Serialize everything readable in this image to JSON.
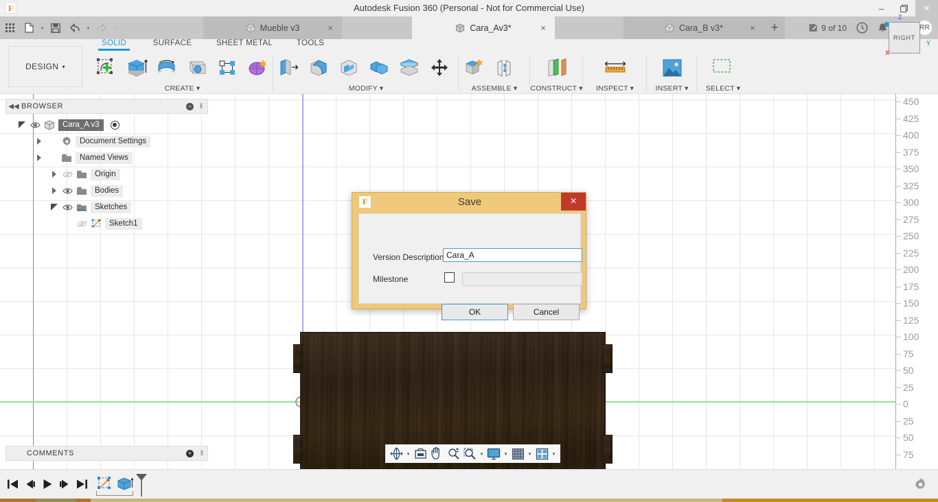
{
  "window": {
    "title": "Autodesk Fusion 360 (Personal - Not for Commercial Use)",
    "logo_glyph": "F",
    "minimize": "–",
    "restore": "❐",
    "close": "×"
  },
  "quick_access": {
    "grid_icon": "app-grid-icon",
    "new_icon": "new-document-icon",
    "save_icon": "save-icon",
    "undo_icon": "undo-icon",
    "redo_icon": "redo-icon",
    "caret": "▾"
  },
  "tabs": [
    {
      "label": "Mueble v3",
      "active": false,
      "close": "×"
    },
    {
      "label": "Cara_Av3*",
      "active": true,
      "close": "×"
    },
    {
      "label": "Cara_B v3*",
      "active": false,
      "close": "×"
    }
  ],
  "tab_extras": {
    "new_tab": "+",
    "jobs_label": "9 of 10",
    "jobs_icon": "job-status-icon",
    "history_icon": "clock-icon",
    "notification_icon": "bell-icon",
    "help_icon": "help-icon",
    "avatar_initials": "RR"
  },
  "ribbon": {
    "workspace_label": "DESIGN",
    "workspace_caret": "▾",
    "tabs": [
      {
        "label": "SOLID",
        "selected": true
      },
      {
        "label": "SURFACE",
        "selected": false
      },
      {
        "label": "SHEET METAL",
        "selected": false
      },
      {
        "label": "TOOLS",
        "selected": false
      }
    ],
    "panels": [
      {
        "title": "CREATE ▾",
        "icons": [
          "create-sketch-icon",
          "extrude-icon",
          "revolve-icon",
          "sweep-icon",
          "rib-icon",
          "form-icon"
        ]
      },
      {
        "title": "MODIFY ▾",
        "icons": [
          "press-pull-icon",
          "fillet-icon",
          "shell-icon",
          "combine-icon",
          "split-face-icon",
          "move-copy-icon"
        ]
      },
      {
        "title": "ASSEMBLE ▾",
        "icons": [
          "new-component-icon",
          "joint-icon"
        ]
      },
      {
        "title": "CONSTRUCT ▾",
        "icons": [
          "offset-plane-icon"
        ]
      },
      {
        "title": "INSPECT ▾",
        "icons": [
          "measure-icon"
        ]
      },
      {
        "title": "INSERT ▾",
        "icons": [
          "insert-image-icon"
        ]
      },
      {
        "title": "SELECT ▾",
        "icons": [
          "select-window-icon"
        ]
      }
    ]
  },
  "browser": {
    "panel_title": "BROWSER",
    "collapse_icon": "collapse-left-icon",
    "minus_icon": "−",
    "grip": "‖",
    "items": [
      {
        "label": "Cara_A v3",
        "indent": 60,
        "icon": "component-icon",
        "eye": "visible",
        "arrow": "open",
        "selected": true,
        "radio": true
      },
      {
        "label": "Document Settings",
        "indent": 85,
        "icon": "gear-icon",
        "eye": "none",
        "arrow": "closed",
        "selected": false,
        "radio": false
      },
      {
        "label": "Named Views",
        "indent": 85,
        "icon": "folder-icon",
        "eye": "none",
        "arrow": "closed",
        "selected": false,
        "radio": false
      },
      {
        "label": "Origin",
        "indent": 107,
        "icon": "folder-icon",
        "eye": "hidden",
        "arrow": "closed",
        "selected": false,
        "radio": false
      },
      {
        "label": "Bodies",
        "indent": 107,
        "icon": "folder-icon",
        "eye": "visible",
        "arrow": "closed",
        "selected": false,
        "radio": false
      },
      {
        "label": "Sketches",
        "indent": 107,
        "icon": "sketch-folder-icon",
        "eye": "visible",
        "arrow": "open",
        "selected": false,
        "radio": false
      },
      {
        "label": "Sketch1",
        "indent": 128,
        "icon": "sketch-icon",
        "eye": "hidden",
        "arrow": "none",
        "selected": false,
        "radio": false
      }
    ]
  },
  "comments": {
    "title": "COMMENTS",
    "plus_icon": "+",
    "grip": "‖"
  },
  "canvas": {
    "viewcube_label": "RIGHT",
    "axis_z": "Z",
    "axis_y": "Y",
    "axis_x": "X",
    "grid_color": "#e6e6e6",
    "ground_line_color": "#8ce88c",
    "sketch_line_color": "#a9a9ee",
    "model_name": "wood-panel-body",
    "model_color": "#2e1f12"
  },
  "ruler": {
    "unit_labels": [
      "450",
      "425",
      "400",
      "375",
      "350",
      "325",
      "300",
      "275",
      "250",
      "225",
      "200",
      "175",
      "150",
      "125",
      "100",
      "75",
      "50",
      "25",
      "0",
      "25",
      "50",
      "75"
    ],
    "zero_index": 18
  },
  "view_toolbar": {
    "items": [
      {
        "icon": "orbit-icon",
        "caret": true
      },
      {
        "icon": "look-at-icon",
        "caret": false
      },
      {
        "icon": "pan-icon",
        "caret": false
      },
      {
        "icon": "zoom-icon",
        "caret": false
      },
      {
        "icon": "zoom-window-icon",
        "caret": true
      },
      {
        "icon": "display-settings-icon",
        "caret": true
      },
      {
        "icon": "grid-snaps-icon",
        "caret": true
      },
      {
        "icon": "viewports-icon",
        "caret": true
      }
    ]
  },
  "timeline": {
    "buttons": [
      {
        "icon": "go-to-beginning-icon"
      },
      {
        "icon": "step-back-icon"
      },
      {
        "icon": "play-icon"
      },
      {
        "icon": "step-forward-icon"
      },
      {
        "icon": "go-to-end-icon"
      }
    ],
    "features": [
      {
        "icon": "sketch-feature-icon"
      },
      {
        "icon": "extrude-feature-icon"
      }
    ],
    "marker_icon": "timeline-marker-icon",
    "settings_icon": "gear-icon"
  },
  "dialog": {
    "title": "Save",
    "logo_glyph": "F",
    "close_glyph": "×",
    "version_description_label": "Version Description",
    "version_description_value": "Cara_A",
    "version_description_placeholder": "",
    "milestone_label": "Milestone",
    "milestone_checked": false,
    "milestone_value": "",
    "milestone_placeholder": "",
    "ok_label": "OK",
    "cancel_label": "Cancel",
    "accent_color": "#eec97a",
    "close_color": "#c0392b"
  }
}
